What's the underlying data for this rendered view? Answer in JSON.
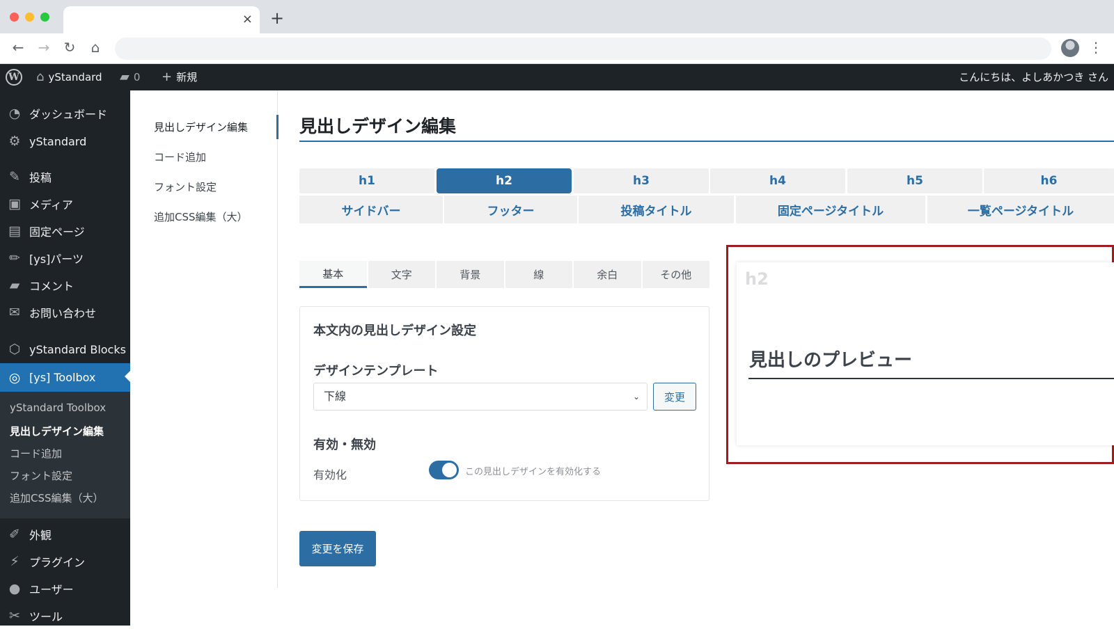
{
  "browser": {
    "tab_close": "×",
    "new_tab": "+",
    "back": "←",
    "forward": "→",
    "reload": "↻",
    "home": "⌂",
    "menu": "⋮"
  },
  "adminbar": {
    "logo": "W",
    "site_name": "yStandard",
    "comments_count": "0",
    "new_label": "新規",
    "greeting": "こんにちは、よしあかつき さん"
  },
  "sidebar": {
    "items": [
      {
        "label": "ダッシュボード",
        "icon": "dashboard-icon",
        "glyph": "◔"
      },
      {
        "label": "yStandard",
        "icon": "gear-icon",
        "glyph": "⚙"
      },
      {
        "label": "投稿",
        "icon": "pin-icon",
        "glyph": "✎"
      },
      {
        "label": "メディア",
        "icon": "media-icon",
        "glyph": "▣"
      },
      {
        "label": "固定ページ",
        "icon": "page-icon",
        "glyph": "▤"
      },
      {
        "label": "[ys]パーツ",
        "icon": "pencil-icon",
        "glyph": "✏"
      },
      {
        "label": "コメント",
        "icon": "comment-icon",
        "glyph": "▰"
      },
      {
        "label": "お問い合わせ",
        "icon": "mail-icon",
        "glyph": "✉"
      },
      {
        "label": "yStandard Blocks",
        "icon": "cube-icon",
        "glyph": "⬡"
      },
      {
        "label": "[ys] Toolbox",
        "icon": "toolbox-icon",
        "glyph": "◎"
      },
      {
        "label": "外観",
        "icon": "brush-icon",
        "glyph": "✐"
      },
      {
        "label": "プラグイン",
        "icon": "plugin-icon",
        "glyph": "⚡"
      },
      {
        "label": "ユーザー",
        "icon": "user-icon",
        "glyph": "●"
      },
      {
        "label": "ツール",
        "icon": "wrench-icon",
        "glyph": "✂"
      }
    ],
    "submenu": [
      "yStandard Toolbox",
      "見出しデザイン編集",
      "コード追加",
      "フォント設定",
      "追加CSS編集（大）"
    ]
  },
  "subnav": [
    "見出しデザイン編集",
    "コード追加",
    "フォント設定",
    "追加CSS編集（大）"
  ],
  "page_title": "見出しデザイン編集",
  "heading_tabs": [
    "h1",
    "h2",
    "h3",
    "h4",
    "h5",
    "h6"
  ],
  "selected_heading_tab": "h2",
  "position_tabs": [
    "サイドバー",
    "フッター",
    "投稿タイトル",
    "固定ページタイトル",
    "一覧ページタイトル"
  ],
  "setting_tabs": [
    "基本",
    "文字",
    "背景",
    "線",
    "余白",
    "その他"
  ],
  "selected_setting_tab": "基本",
  "card": {
    "title": "本文内の見出しデザイン設定",
    "template_label": "デザインテンプレート",
    "template_value": "下線",
    "chevron": "⌄",
    "change_button": "変更",
    "enable_label": "有効・無効",
    "toggle_label": "有効化",
    "toggle_text": "この見出しデザインを有効化する",
    "toggle_on": true
  },
  "save_button": "変更を保存",
  "preview": {
    "tag": "h2",
    "heading": "見出しのプレビュー",
    "frame_color": "#a11a1e"
  },
  "colors": {
    "accent": "#2c6ea4",
    "admin_dark": "#1d2327",
    "wp_blue": "#2271b1"
  }
}
